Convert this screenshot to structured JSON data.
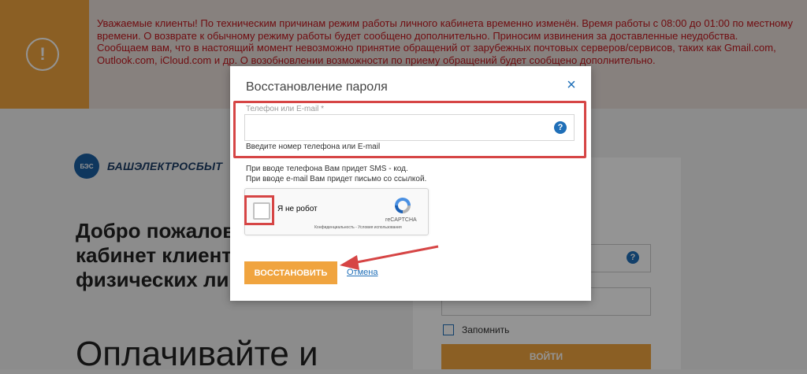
{
  "banner": {
    "icon": "exclamation-icon",
    "line1": "Уважаемые клиенты! По техническим причинам режим работы личного кабинета временно изменён. Время работы с 08:00 до 01:00 по местному времени. О возврате к обычному режиму работы будет сообщено дополнительно. Приносим извинения за доставленные неудобства.",
    "line2": "Сообщаем вам, что в настоящий момент невозможно принятие обращений от зарубежных почтовых серверов/сервисов, таких как Gmail.com, Outlook.com, iCloud.com и др. О возобновлении возможности по приему обращений будет сообщено дополнительно."
  },
  "logo": {
    "mark": "БЭС",
    "text": "БАШЭЛЕКТРОСБЫТ"
  },
  "welcome": {
    "line1": "Добро пожаловать в личный",
    "line2": "кабинет клиента",
    "line3": "физических лиц"
  },
  "big_text": "Оплачивайте и",
  "login": {
    "remember_label": "Запомнить",
    "login_button": "ВОЙТИ",
    "help": "?"
  },
  "modal": {
    "title": "Восстановление пароля",
    "close": "×",
    "field_label": "Телефон или E-mail *",
    "field_value": "",
    "field_help": "?",
    "field_hint": "Введите номер телефона или E-mail",
    "info_line1": "При вводе телефона Вам придет SMS - код.",
    "info_line2": "При вводе e-mail Вам придет письмо со ссылкой.",
    "captcha_label": "Я не робот",
    "captcha_brand": "reCAPTCHA",
    "captcha_links": "Конфиденциальность - Условия использования",
    "restore_button": "ВОССТАНОВИТЬ",
    "cancel_link": "Отмена"
  },
  "colors": {
    "accent": "#f0a43f",
    "link": "#1f6fb8",
    "alert": "#c2171e",
    "highlight": "#d64545"
  }
}
